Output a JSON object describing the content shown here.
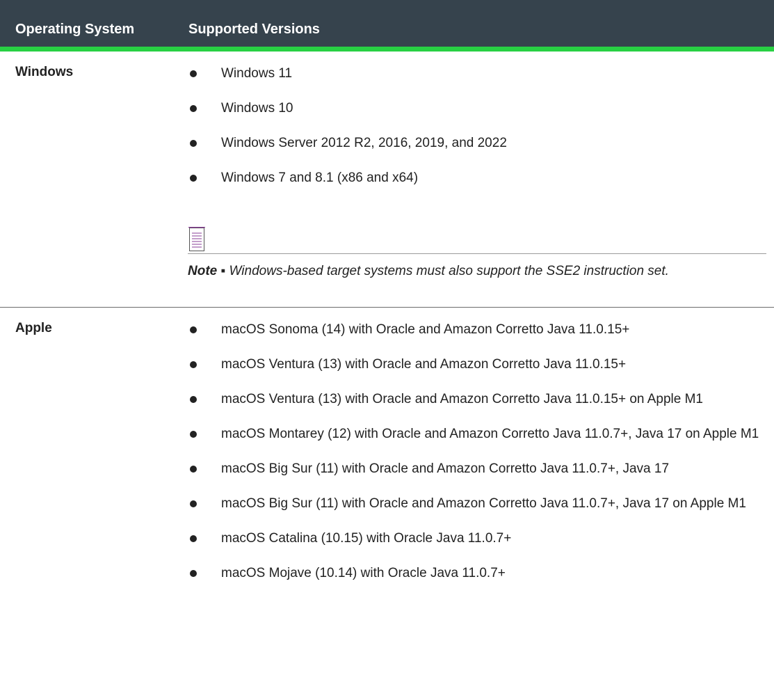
{
  "header": {
    "col1": "Operating System",
    "col2": "Supported Versions"
  },
  "rows": [
    {
      "os": "Windows",
      "versions": [
        "Windows 11",
        "Windows 10",
        "Windows Server 2012 R2, 2016, 2019, and 2022",
        "Windows 7 and 8.1 (x86 and x64)"
      ],
      "note": {
        "icon": "note-document-icon",
        "label": "Note ▪",
        "text": "Windows-based target systems must also support the SSE2 instruction set."
      }
    },
    {
      "os": "Apple",
      "versions": [
        "macOS Sonoma (14) with Oracle and Amazon Corretto Java 11.0.15+",
        "macOS Ventura (13) with Oracle and Amazon Corretto Java 11.0.15+",
        "macOS Ventura (13) with Oracle and Amazon Corretto Java 11.0.15+ on Apple M1",
        "macOS Montarey (12) with Oracle and Amazon Corretto Java 11.0.7+, Java 17 on Apple M1",
        "macOS Big Sur (11) with Oracle and Amazon Corretto Java 11.0.7+, Java 17",
        "macOS Big Sur (11) with Oracle and Amazon Corretto Java 11.0.7+, Java 17 on Apple M1",
        "macOS Catalina (10.15) with Oracle Java 11.0.7+",
        "macOS Mojave (10.14) with Oracle Java 11.0.7+"
      ]
    }
  ],
  "colors": {
    "header_bg": "#36434d",
    "header_accent": "#28d043",
    "note_icon_accent": "#8a3c97"
  }
}
